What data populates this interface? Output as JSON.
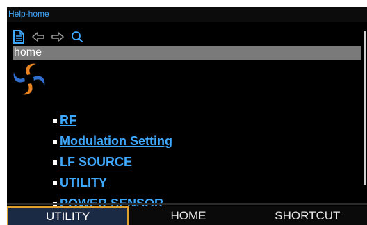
{
  "window": {
    "title": "Help-home"
  },
  "toolbar": {
    "icons": [
      "contents-icon",
      "back-icon",
      "forward-icon",
      "search-icon"
    ]
  },
  "address": {
    "value": "home"
  },
  "topics": [
    {
      "label": "RF"
    },
    {
      "label": "Modulation Setting"
    },
    {
      "label": "LF SOURCE"
    },
    {
      "label": "UTILITY"
    },
    {
      "label": "POWER SENSOR"
    }
  ],
  "softkeys": [
    {
      "label": "UTILITY",
      "active": true
    },
    {
      "label": "HOME",
      "active": false
    },
    {
      "label": "SHORTCUT",
      "active": false
    }
  ],
  "colors": {
    "link": "#3fa9ff",
    "accent_orange": "#e8821e",
    "accent_blue": "#2f6fd0",
    "softkey_highlight": "#e0a030"
  }
}
